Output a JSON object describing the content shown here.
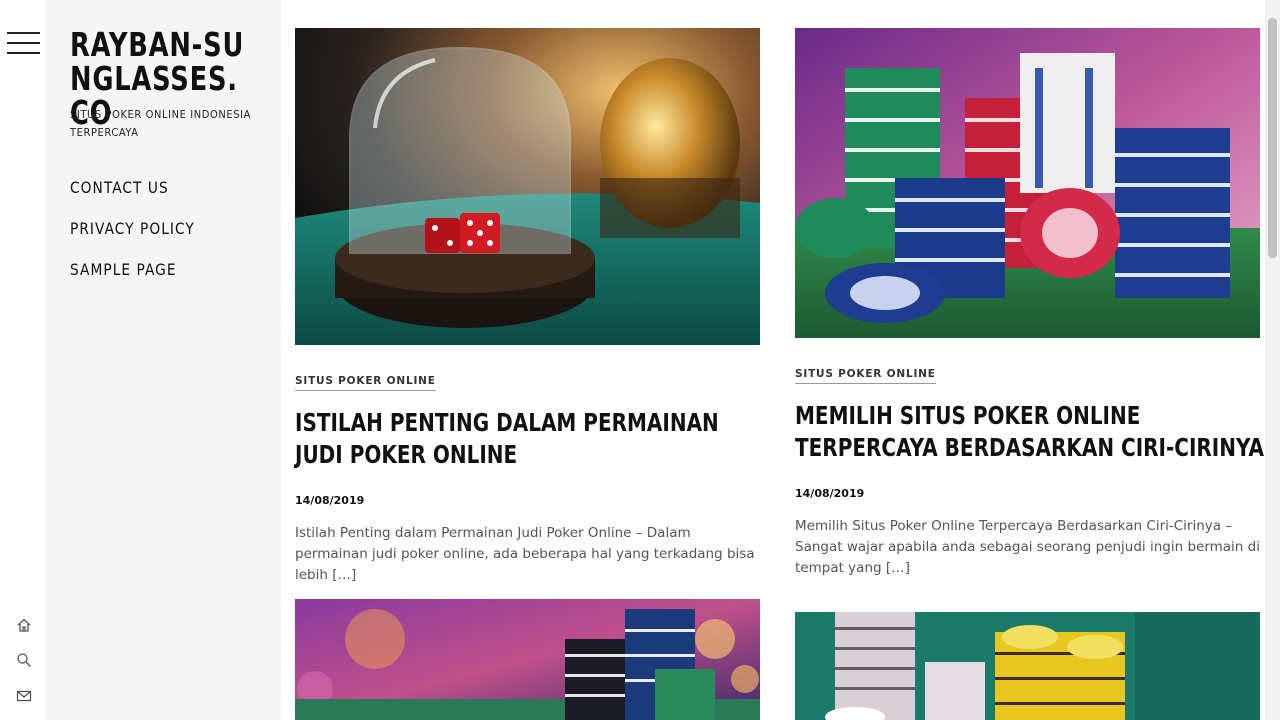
{
  "site": {
    "title": "RAYBAN-SUNGLASSES.CO",
    "tagline": "SITUS POKER ONLINE INDONESIA TERPERCAYA"
  },
  "menu": {
    "items": [
      {
        "label": "CONTACT US"
      },
      {
        "label": "PRIVACY POLICY"
      },
      {
        "label": "SAMPLE PAGE"
      }
    ]
  },
  "rail": {
    "icons": [
      "menu-icon",
      "home-icon",
      "search-icon",
      "mail-icon"
    ]
  },
  "posts": [
    {
      "category": "SITUS POKER ONLINE",
      "title": "ISTILAH PENTING DALAM PERMAINAN JUDI POKER ONLINE",
      "date": "14/08/2019",
      "excerpt": "Istilah Penting dalam Permainan Judi Poker Online – Dalam permainan judi poker online, ada beberapa hal yang terkadang bisa lebih […]",
      "image": "casino-dice-dome-photo"
    },
    {
      "category": "SITUS POKER ONLINE",
      "title": "MEMILIH SITUS POKER ONLINE TERPERCAYA BERDASARKAN CIRI-CIRINYA",
      "date": "14/08/2019",
      "excerpt": "Memilih Situs Poker Online Terpercaya Berdasarkan Ciri-Cirinya – Sangat wajar apabila anda sebagai seorang penjudi ingin bermain di tempat yang […]",
      "image": "poker-chip-stacks-photo"
    },
    {
      "image": "casino-chips-bokeh-photo"
    },
    {
      "image": "poker-chips-table-photo"
    }
  ],
  "colors": {
    "sidebar_bg": "#f5f5f5",
    "text": "#111111",
    "excerpt": "#555555"
  }
}
